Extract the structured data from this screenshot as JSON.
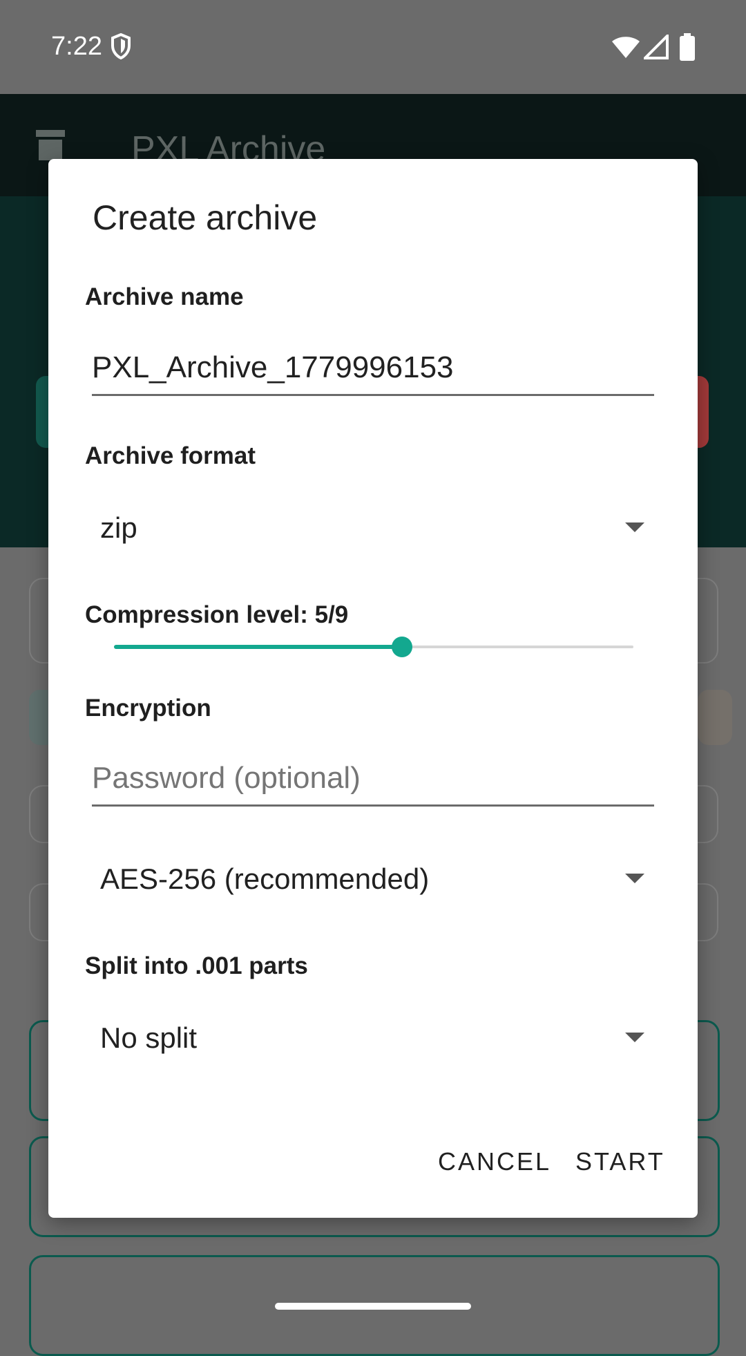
{
  "status_bar": {
    "time": "7:22"
  },
  "app": {
    "title": "PXL Archive"
  },
  "dialog": {
    "title": "Create archive",
    "archive_name": {
      "label": "Archive name",
      "value": "PXL_Archive_1779996153"
    },
    "archive_format": {
      "label": "Archive format",
      "selected": "zip"
    },
    "compression": {
      "label": "Compression level: 5/9",
      "level": 5,
      "max": 9,
      "fill_fraction": 0.555
    },
    "encryption": {
      "label": "Encryption",
      "password_placeholder": "Password (optional)",
      "method_selected": "AES-256 (recommended)"
    },
    "split": {
      "label": "Split into .001 parts",
      "selected": "No split"
    },
    "actions": {
      "cancel": "CANCEL",
      "start": "START"
    }
  },
  "colors": {
    "accent": "#13a88f",
    "scrim": "#6b6b6b",
    "dialog_bg": "#ffffff"
  },
  "icons": [
    "shield-icon",
    "wifi-icon",
    "signal-icon",
    "battery-icon",
    "archive-icon",
    "dropdown-arrow-icon"
  ]
}
